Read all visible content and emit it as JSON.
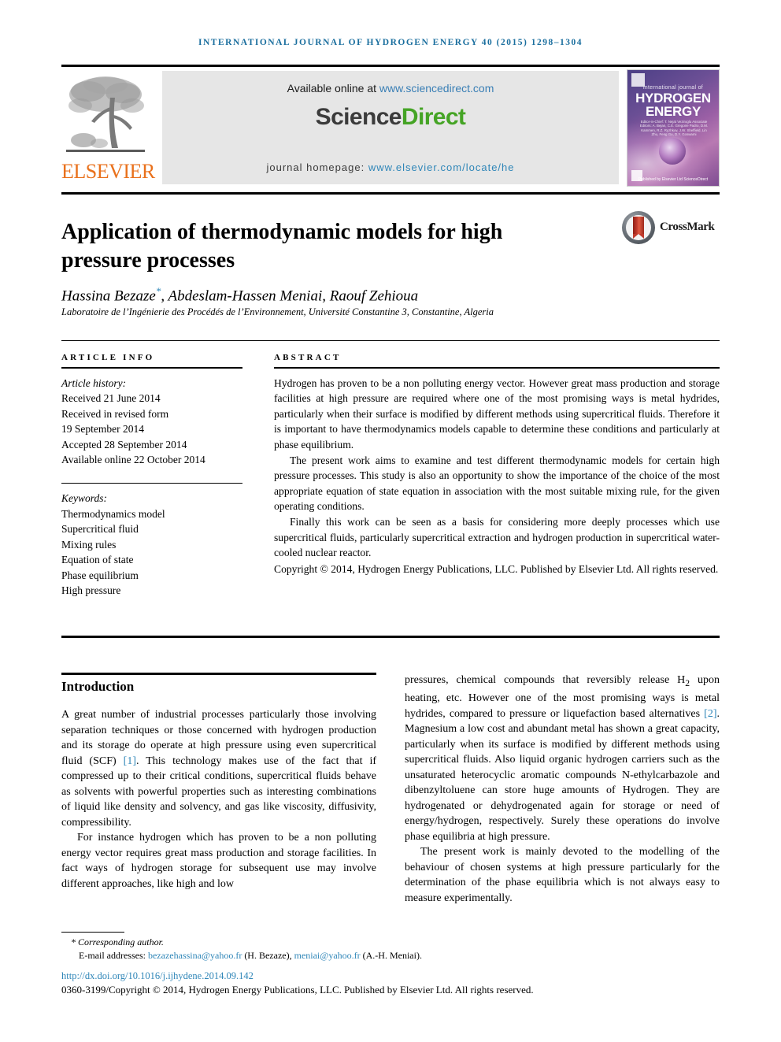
{
  "running_head": "INTERNATIONAL JOURNAL OF HYDROGEN ENERGY 40 (2015) 1298–1304",
  "masthead": {
    "publisher_name": "ELSEVIER",
    "available_prefix": "Available online at ",
    "available_url": "www.sciencedirect.com",
    "sciencedirect_part1": "Science",
    "sciencedirect_part2": "Direct",
    "homepage_label": "journal homepage: ",
    "homepage_url": "www.elsevier.com/locate/he",
    "cover": {
      "line_top": "international journal of",
      "line_hydrogen": "HYDROGEN",
      "line_energy": "ENERGY",
      "editors": "Editor-in-Chief: T. Nejat Veziroglu   Associate Editors: A. Bejan, C.E. Gregoire Padro, D.M. Kammen, R.Z. Ryzhkov, J.W. Sheffield, Lin Zhu, Feng Gu, D.Y. Goswami",
      "footer": "Published by Elsevier Ltd  ScienceDirect"
    }
  },
  "crossmark": {
    "label": "CrossMark"
  },
  "article": {
    "title": "Application of thermodynamic models for high pressure processes",
    "authors_part1": "Hassina Bezaze",
    "authors_star": "*",
    "authors_part2": ", Abdeslam-Hassen Meniai, Raouf Zehioua",
    "affiliation": "Laboratoire de l’Ingénierie des Procédés de l’Environnement, Université Constantine 3, Constantine, Algeria"
  },
  "article_info": {
    "heading": "ARTICLE INFO",
    "history_label": "Article history:",
    "history": [
      "Received 21 June 2014",
      "Received in revised form",
      "19 September 2014",
      "Accepted 28 September 2014",
      "Available online 22 October 2014"
    ],
    "keywords_label": "Keywords:",
    "keywords": [
      "Thermodynamics model",
      "Supercritical fluid",
      "Mixing rules",
      "Equation of state",
      "Phase equilibrium",
      "High pressure"
    ]
  },
  "abstract": {
    "heading": "ABSTRACT",
    "paragraphs": [
      "Hydrogen has proven to be a non polluting energy vector. However great mass production and storage facilities at high pressure are required where one of the most promising ways is metal hydrides, particularly when their surface is modified by different methods using supercritical fluids. Therefore it is important to have thermodynamics models capable to determine these conditions and particularly at phase equilibrium.",
      "The present work aims to examine and test different thermodynamic models for certain high pressure processes. This study is also an opportunity to show the importance of the choice of the most appropriate equation of state equation in association with the most suitable mixing rule, for the given operating conditions.",
      "Finally this work can be seen as a basis for considering more deeply processes which use supercritical fluids, particularly supercritical extraction and hydrogen production in supercritical water-cooled nuclear reactor."
    ],
    "copyright": "Copyright © 2014, Hydrogen Energy Publications, LLC. Published by Elsevier Ltd. All rights reserved."
  },
  "introduction": {
    "heading": "Introduction",
    "left_p1_a": "A great number of industrial processes particularly those involving separation techniques or those concerned with hydrogen production and its storage do operate at high pressure using even supercritical fluid (SCF) ",
    "left_p1_ref": "[1]",
    "left_p1_b": ". This technology makes use of the fact that if compressed up to their critical conditions, supercritical fluids behave as solvents with powerful properties such as interesting combinations of liquid like density and solvency, and gas like viscosity, diffusivity, compressibility.",
    "left_p2": "For instance hydrogen which has proven to be a non polluting energy vector requires great mass production and storage facilities. In fact ways of hydrogen storage for subsequent use may involve different approaches, like high and low",
    "right_p1_a": "pressures, chemical compounds that reversibly release H",
    "right_p1_sub": "2",
    "right_p1_b": " upon heating, etc. However one of the most promising ways is metal hydrides, compared to pressure or liquefaction based alternatives ",
    "right_p1_ref": "[2]",
    "right_p1_c": ". Magnesium a low cost and abundant metal has shown a great capacity, particularly when its surface is modified by different methods using supercritical fluids. Also liquid organic hydrogen carriers such as the unsaturated heterocyclic aromatic compounds N-ethylcarbazole and dibenzyltoluene can store huge amounts of Hydrogen. They are hydrogenated or dehydrogenated again for storage or need of energy/hydrogen, respectively. Surely these operations do involve phase equilibria at high pressure.",
    "right_p2": "The present work is mainly devoted to the modelling of the behaviour of chosen systems at high pressure particularly for the determination of the phase equilibria which is not always easy to measure experimentally."
  },
  "footer": {
    "corresponding": "* Corresponding author.",
    "email_label": "E-mail addresses: ",
    "email1": "bezazehassina@yahoo.fr",
    "email1_name": " (H. Bezaze), ",
    "email2": "meniai@yahoo.fr",
    "email2_name": " (A.-H. Meniai).",
    "doi": "http://dx.doi.org/10.1016/j.ijhydene.2014.09.142",
    "copyright": "0360-3199/Copyright © 2014, Hydrogen Energy Publications, LLC. Published by Elsevier Ltd. All rights reserved."
  },
  "colors": {
    "running_head": "#1a6e9e",
    "link": "#2f86b8",
    "elsevier_orange": "#E9711C",
    "sciencedirect_green": "#45a425"
  }
}
